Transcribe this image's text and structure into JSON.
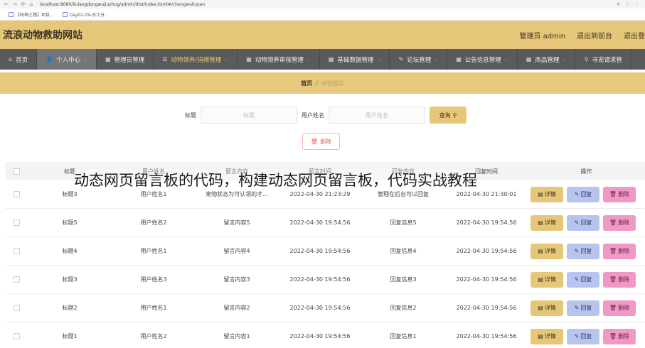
{
  "browser": {
    "nav_glyphs": [
      "←",
      "→",
      "⟳",
      "⌂"
    ],
    "url": "localhost:8080/liulangdongwujiuzhug/admin/dist/index.html#/chongwuliuyan",
    "right_glyphs": [
      "⚲",
      "☆",
      "⋮"
    ],
    "bookmarks": [
      {
        "label": "【码神之路】项目..."
      },
      {
        "label": "Day02-09-员工分..."
      }
    ]
  },
  "header": {
    "title": "流浪动物救助网站",
    "admin_label": "管理员 admin",
    "to_front_label": "退出到前台",
    "logout_label": "退出登"
  },
  "nav": {
    "items": [
      {
        "label": "首页",
        "icon": "⌂"
      },
      {
        "label": "个人中心",
        "icon": "👤"
      },
      {
        "label": "管理员管理",
        "icon": "▦"
      },
      {
        "label": "动物领养/捐赠管理",
        "icon": "☰"
      },
      {
        "label": "动物领养审核管理",
        "icon": "▦"
      },
      {
        "label": "基础数据管理",
        "icon": "▦"
      },
      {
        "label": "论坛管理",
        "icon": "✎"
      },
      {
        "label": "公告信息管理",
        "icon": "▦"
      },
      {
        "label": "商品管理",
        "icon": "▦"
      },
      {
        "label": "寻宠请求管",
        "icon": "⚲"
      }
    ],
    "caret": "⌄"
  },
  "breadcrumb": {
    "home": "首页",
    "sep": "/",
    "current": "动物留言"
  },
  "search": {
    "title_label": "标题",
    "title_placeholder": "标题",
    "user_label": "用户姓名",
    "user_placeholder": "用户姓名",
    "query_label": "查询",
    "query_icon": "⚲"
  },
  "delete_button": {
    "label": "删除",
    "icon": "🗑"
  },
  "table": {
    "headers": {
      "title": "标题",
      "user": "用户姓名",
      "content": "留言内容",
      "time": "留言时间",
      "reply": "回复内容",
      "reply_time": "回复时间",
      "ops": "操作"
    },
    "ops": {
      "detail": "详情",
      "reply": "回复",
      "remove": "删除",
      "detail_icon": "▤",
      "reply_icon": "✎",
      "remove_icon": "🗑"
    },
    "rows": [
      {
        "title": "标题3",
        "user": "用户姓名1",
        "content": "宠物状态为可认领的才...",
        "time": "2022-04-30 21:23:29",
        "reply": "管理在后台可以回复",
        "reply_time": "2022-04-30 21:30:01"
      },
      {
        "title": "标题5",
        "user": "用户姓名2",
        "content": "留言内容5",
        "time": "2022-04-30 19:54:56",
        "reply": "回复信息5",
        "reply_time": "2022-04-30 19:54:56"
      },
      {
        "title": "标题4",
        "user": "用户姓名1",
        "content": "留言内容4",
        "time": "2022-04-30 19:54:56",
        "reply": "回复信息4",
        "reply_time": "2022-04-30 19:54:56"
      },
      {
        "title": "标题3",
        "user": "用户姓名3",
        "content": "留言内容3",
        "time": "2022-04-30 19:54:56",
        "reply": "回复信息3",
        "reply_time": "2022-04-30 19:54:56"
      },
      {
        "title": "标题2",
        "user": "用户姓名1",
        "content": "留言内容2",
        "time": "2022-04-30 19:54:56",
        "reply": "回复信息2",
        "reply_time": "2022-04-30 19:54:56"
      },
      {
        "title": "标题1",
        "user": "用户姓名2",
        "content": "留言内容1",
        "time": "2022-04-30 19:54:56",
        "reply": "回复信息1",
        "reply_time": "2022-04-30 19:54:56"
      }
    ]
  },
  "overlay_caption": "动态网页留言板的代码，构建动态网页留言板，代码实战教程",
  "colors": {
    "header_bg": "#e6c77a",
    "nav_bg": "#5a5a5a",
    "detail_btn": "#e6c77a",
    "reply_btn": "#b9c4ee",
    "remove_btn": "#f098c6"
  }
}
